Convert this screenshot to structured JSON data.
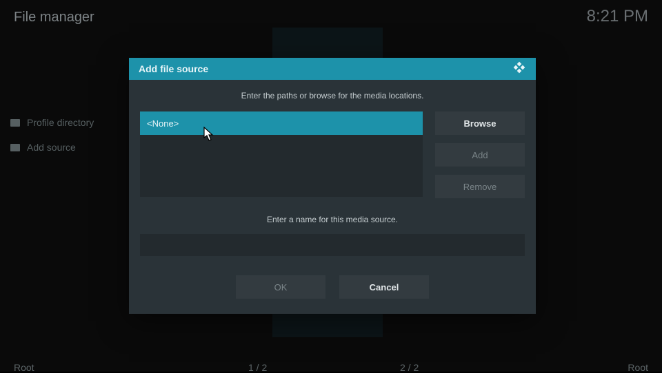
{
  "header": {
    "title": "File manager",
    "time": "8:21 PM"
  },
  "sidebar": {
    "items": [
      {
        "label": "Profile directory"
      },
      {
        "label": "Add source"
      }
    ]
  },
  "dialog": {
    "title": "Add file source",
    "instruction_paths": "Enter the paths or browse for the media locations.",
    "path_value": "<None>",
    "browse_label": "Browse",
    "add_label": "Add",
    "remove_label": "Remove",
    "instruction_name": "Enter a name for this media source.",
    "name_value": "",
    "ok_label": "OK",
    "cancel_label": "Cancel"
  },
  "footer": {
    "left": "Root",
    "mid1": "1 / 2",
    "mid2": "2 / 2",
    "right": "Root"
  }
}
